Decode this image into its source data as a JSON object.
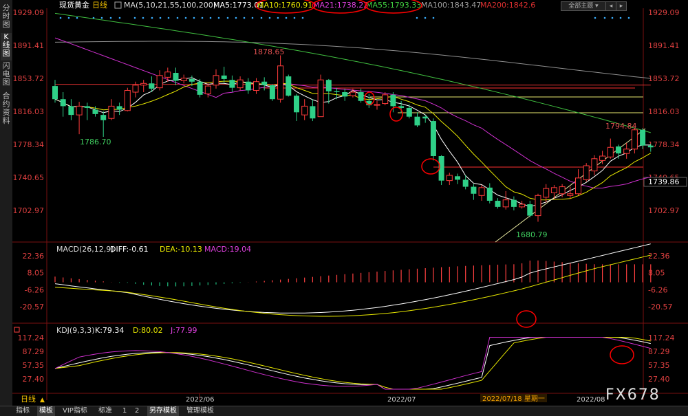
{
  "sidebar": {
    "tabs": [
      "分时图",
      "K线图",
      "闪电图",
      "合约资料"
    ],
    "active": 1
  },
  "header": {
    "title": "现货黄金",
    "period": "日线",
    "ma_params": "MA(5,10,21,55,100,200)",
    "ma5": "MA5:1773.01",
    "ma10": "MA10:1760.91",
    "ma21": "MA21:1738.22",
    "ma55": "MA55:1793.33",
    "ma100": "MA100:1843.47",
    "ma200": "MA200:1842.6",
    "theme_button": "全部主题",
    "colors": {
      "ma5": "#ffffff",
      "ma10": "#e8e800",
      "ma21": "#e040e0",
      "ma55": "#40d040",
      "ma100": "#a0a0a0",
      "ma200": "#e03030"
    }
  },
  "price_axis": {
    "left": [
      "1929.09",
      "1891.41",
      "1853.72",
      "1816.03",
      "1778.34",
      "1740.65",
      "1702.97"
    ],
    "right": [
      "1929.09",
      "1891.41",
      "1853.72",
      "1816.03",
      "1778.34",
      "1740.65",
      "1702.97"
    ],
    "current": "1739.86"
  },
  "annotations": {
    "high1": "1878.65",
    "low1": "1786.70",
    "low2": "1680.79",
    "high2": "1794.84"
  },
  "macd": {
    "title": "MACD(26,12,9)",
    "diff": "DIFF:-0.61",
    "dea": "DEA:-10.13",
    "macd": "MACD:19.04",
    "axis": [
      "22.36",
      "8.05",
      "-6.26",
      "-20.57"
    ]
  },
  "kdj": {
    "title": "KDJ(9,3,3)",
    "k": "K:79.34",
    "d": "D:80.02",
    "j": "J:77.99",
    "axis": [
      "117.24",
      "87.29",
      "57.35",
      "27.40"
    ]
  },
  "time_axis": {
    "labels": [
      "2022/06",
      "2022/07",
      "2022/07/18 星期一",
      "2022/08"
    ]
  },
  "period_selector": "日线",
  "watermark": "FX678",
  "bottom_tabs": [
    "指标",
    "模板",
    "VIP指标",
    "标准",
    "1",
    "2",
    "另存模板",
    "管理模板"
  ],
  "chart_data": {
    "type": "candlestick",
    "title": "现货黄金 日线",
    "ylim": [
      1680,
      1935
    ],
    "candles": [
      [
        1845,
        1830,
        1852,
        1826
      ],
      [
        1830,
        1822,
        1838,
        1810
      ],
      [
        1822,
        1812,
        1830,
        1806
      ],
      [
        1812,
        1822,
        1827,
        1790
      ],
      [
        1822,
        1820,
        1826,
        1806
      ],
      [
        1818,
        1813,
        1822,
        1810
      ],
      [
        1812,
        1806,
        1816,
        1787
      ],
      [
        1808,
        1822,
        1830,
        1806
      ],
      [
        1822,
        1818,
        1826,
        1812
      ],
      [
        1817,
        1840,
        1843,
        1816
      ],
      [
        1838,
        1846,
        1850,
        1832
      ],
      [
        1846,
        1848,
        1852,
        1838
      ],
      [
        1848,
        1842,
        1856,
        1838
      ],
      [
        1843,
        1857,
        1863,
        1840
      ],
      [
        1855,
        1861,
        1866,
        1850
      ],
      [
        1860,
        1851,
        1866,
        1846
      ],
      [
        1851,
        1854,
        1858,
        1848
      ],
      [
        1853,
        1850,
        1857,
        1845
      ],
      [
        1850,
        1835,
        1853,
        1832
      ],
      [
        1836,
        1845,
        1849,
        1832
      ],
      [
        1846,
        1857,
        1864,
        1842
      ],
      [
        1857,
        1853,
        1867,
        1849
      ],
      [
        1852,
        1843,
        1857,
        1838
      ],
      [
        1843,
        1852,
        1856,
        1840
      ],
      [
        1850,
        1840,
        1854,
        1836
      ],
      [
        1840,
        1850,
        1854,
        1836
      ],
      [
        1850,
        1846,
        1855,
        1840
      ],
      [
        1846,
        1830,
        1847,
        1828
      ],
      [
        1830,
        1868,
        1880,
        1826
      ],
      [
        1856,
        1834,
        1858,
        1833
      ],
      [
        1834,
        1815,
        1836,
        1805
      ],
      [
        1812,
        1822,
        1830,
        1806
      ],
      [
        1822,
        1808,
        1830,
        1805
      ],
      [
        1810,
        1852,
        1858,
        1810
      ],
      [
        1852,
        1839,
        1853,
        1825
      ],
      [
        1839,
        1838,
        1843,
        1830
      ],
      [
        1838,
        1833,
        1842,
        1828
      ],
      [
        1834,
        1838,
        1842,
        1832
      ],
      [
        1838,
        1828,
        1842,
        1826
      ],
      [
        1828,
        1823,
        1836,
        1820
      ],
      [
        1823,
        1824,
        1828,
        1818
      ],
      [
        1825,
        1835,
        1838,
        1823
      ],
      [
        1835,
        1822,
        1838,
        1815
      ],
      [
        1822,
        1820,
        1828,
        1815
      ],
      [
        1820,
        1810,
        1824,
        1808
      ],
      [
        1810,
        1800,
        1815,
        1798
      ],
      [
        1810,
        1808,
        1812,
        1803
      ],
      [
        1805,
        1765,
        1808,
        1760
      ],
      [
        1765,
        1737,
        1766,
        1732
      ],
      [
        1737,
        1743,
        1746,
        1732
      ],
      [
        1742,
        1738,
        1745,
        1733
      ],
      [
        1738,
        1730,
        1743,
        1727
      ],
      [
        1730,
        1722,
        1733,
        1715
      ],
      [
        1720,
        1729,
        1732,
        1714
      ],
      [
        1729,
        1714,
        1734,
        1711
      ],
      [
        1714,
        1707,
        1717,
        1705
      ],
      [
        1707,
        1715,
        1725,
        1704
      ],
      [
        1715,
        1707,
        1719,
        1703
      ],
      [
        1707,
        1710,
        1714,
        1705
      ],
      [
        1710,
        1697,
        1714,
        1695
      ],
      [
        1697,
        1720,
        1722,
        1690
      ],
      [
        1718,
        1728,
        1733,
        1712
      ],
      [
        1723,
        1729,
        1732,
        1716
      ],
      [
        1722,
        1730,
        1733,
        1718
      ],
      [
        1720,
        1722,
        1730,
        1716
      ],
      [
        1722,
        1740,
        1750,
        1720
      ],
      [
        1738,
        1754,
        1757,
        1736
      ],
      [
        1748,
        1762,
        1766,
        1743
      ],
      [
        1760,
        1765,
        1771,
        1756
      ],
      [
        1764,
        1775,
        1785,
        1762
      ],
      [
        1776,
        1768,
        1778,
        1762
      ],
      [
        1768,
        1773,
        1780,
        1762
      ],
      [
        1773,
        1795,
        1797,
        1768
      ],
      [
        1795,
        1777,
        1797,
        1773
      ],
      [
        1777,
        1775,
        1779,
        1770
      ]
    ]
  }
}
